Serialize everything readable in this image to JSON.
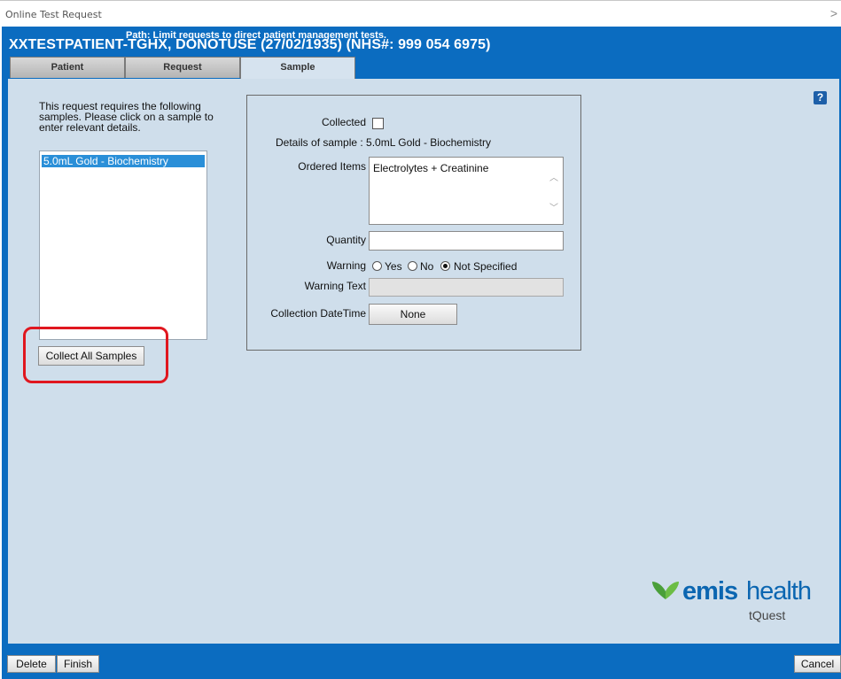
{
  "window": {
    "title": "Online Test Request",
    "close_glyph": ">"
  },
  "header": {
    "path_text": "Path: Limit requests to direct patient management tests.",
    "patient_line": "XXTESTPATIENT-TGHX, DONOTUSE (27/02/1935)  (NHS#: 999 054 6975)"
  },
  "tabs": [
    {
      "label": "Patient"
    },
    {
      "label": "Request"
    },
    {
      "label": "Sample"
    }
  ],
  "help_label": "?",
  "samples": {
    "instructions": "This request requires the following samples. Please click on a sample to enter relevant details.",
    "items": [
      "5.0mL Gold - Biochemistry"
    ],
    "collect_all_label": "Collect All Samples"
  },
  "form": {
    "collected_label": "Collected",
    "details_text": "Details of sample : 5.0mL Gold - Biochemistry",
    "ordered_items_label": "Ordered Items",
    "ordered_items_value": "Electrolytes + Creatinine",
    "quantity_label": "Quantity",
    "quantity_value": "",
    "warning_label": "Warning",
    "warning_options": [
      "Yes",
      "No",
      "Not Specified"
    ],
    "warning_selected": "Not Specified",
    "warning_text_label": "Warning Text",
    "warning_text_value": "",
    "collection_label": "Collection DateTime",
    "collection_button": "None"
  },
  "brand": {
    "emis": "emis",
    "health": "health",
    "product": "tQuest",
    "color": "#0b66b1"
  },
  "footer": {
    "delete_label": "Delete",
    "finish_label": "Finish",
    "cancel_label": "Cancel"
  },
  "colors": {
    "frame_blue": "#0b6cc0",
    "content_bg": "#cfdeeb",
    "highlight_red": "#e0171f"
  }
}
